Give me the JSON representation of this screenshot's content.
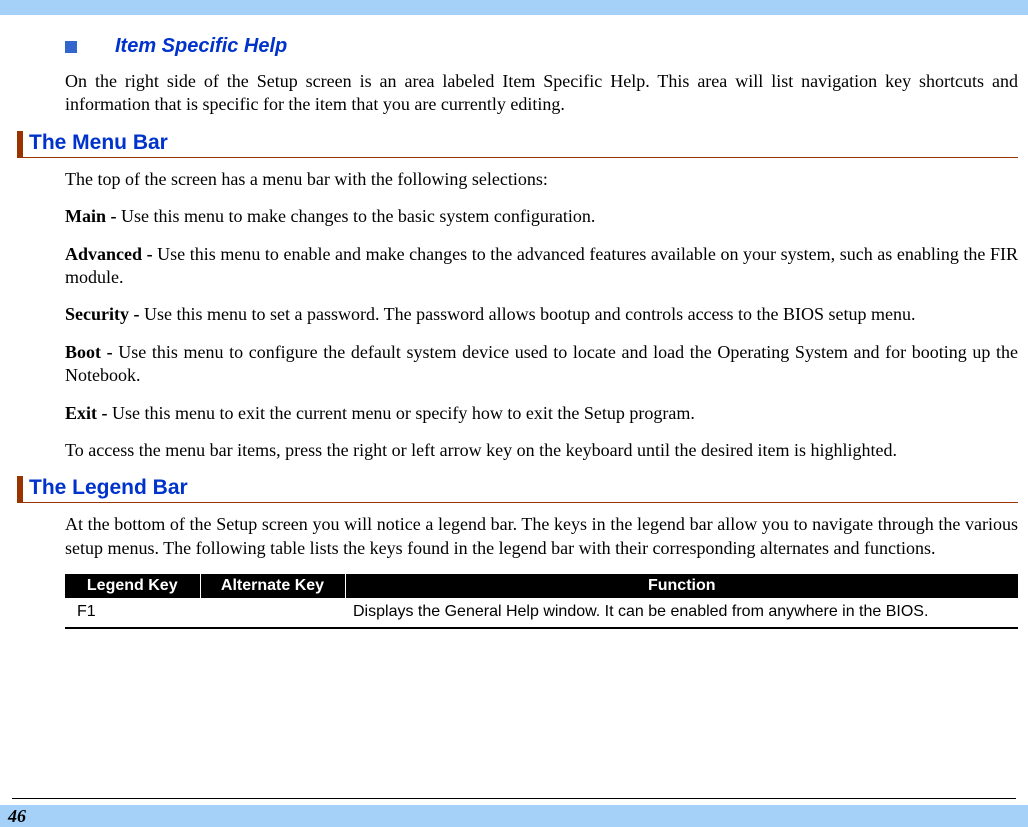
{
  "itemHelp": {
    "title": "Item Specific Help",
    "body": "On the right side of the Setup screen is an area labeled Item Specific Help.  This area will list navigation key shortcuts and information that is specific for the item that you are currently editing."
  },
  "menuBar": {
    "title": "The Menu Bar",
    "intro": "The top of the screen has a menu bar with the following selections:",
    "items": [
      {
        "lead": "Main - ",
        "text": "Use this menu to make changes to the basic system configuration."
      },
      {
        "lead": "Advanced - ",
        "text": "Use this menu to enable and make changes to the advanced features available on your system, such as enabling the FIR module."
      },
      {
        "lead": "Security - ",
        "text": "Use this menu to set a password. The password allows bootup and controls access to the BIOS setup menu."
      },
      {
        "lead": "Boot - ",
        "text": "Use this menu to configure the default system device used to locate and load the Operating System and for booting up the Notebook."
      },
      {
        "lead": "Exit - ",
        "text": "Use this menu to exit the current menu or specify how to exit the Setup program."
      }
    ],
    "outro": "To access the menu bar items, press the right or left arrow key on the keyboard until the desired item is highlighted."
  },
  "legendBar": {
    "title": "The Legend Bar",
    "intro": "At the bottom of the Setup screen you will notice a legend bar. The keys in the legend bar allow you to navigate through the various setup menus. The following table lists the keys found in the legend bar with their corresponding alternates and functions.",
    "table": {
      "headers": {
        "legend": "Legend Key",
        "alt": "Alternate Key",
        "func": "Function"
      },
      "rows": [
        {
          "legend": "F1",
          "alt": "",
          "func": "Displays the General Help window.  It can be enabled from anywhere in the BIOS."
        }
      ]
    }
  },
  "pageNumber": "46"
}
